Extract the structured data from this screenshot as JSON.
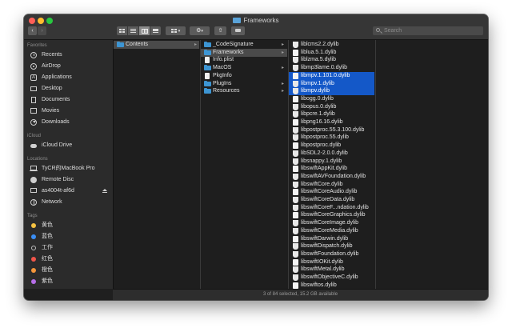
{
  "window": {
    "title": "Frameworks"
  },
  "toolbar": {
    "back_icon": "chevron-left-icon",
    "forward_icon": "chevron-right-icon",
    "view_modes": [
      "icons",
      "list",
      "columns",
      "gallery"
    ],
    "active_view": "columns",
    "search_placeholder": "Search"
  },
  "sidebar": {
    "favorites_header": "Favorites",
    "favorites": [
      {
        "label": "Recents",
        "icon": "recents-icon"
      },
      {
        "label": "AirDrop",
        "icon": "airdrop-icon"
      },
      {
        "label": "Applications",
        "icon": "applications-icon"
      },
      {
        "label": "Desktop",
        "icon": "desktop-icon"
      },
      {
        "label": "Documents",
        "icon": "documents-icon"
      },
      {
        "label": "Movies",
        "icon": "movies-icon"
      },
      {
        "label": "Downloads",
        "icon": "downloads-icon"
      }
    ],
    "icloud_header": "iCloud",
    "icloud": [
      {
        "label": "iCloud Drive",
        "icon": "cloud-icon"
      }
    ],
    "locations_header": "Locations",
    "locations": [
      {
        "label": "TyCR的MacBook Pro",
        "icon": "laptop-icon"
      },
      {
        "label": "Remote Disc",
        "icon": "disc-icon"
      },
      {
        "label": "as4004t-af6d",
        "icon": "display-icon"
      },
      {
        "label": "Network",
        "icon": "network-icon"
      }
    ],
    "tags_header": "Tags",
    "tags": [
      {
        "label": "黄色",
        "color": "#f5c242"
      },
      {
        "label": "蓝色",
        "color": "#3a8ef5"
      },
      {
        "label": "工作",
        "color": "#00000000"
      },
      {
        "label": "红色",
        "color": "#f0554a"
      },
      {
        "label": "橙色",
        "color": "#f5963a"
      },
      {
        "label": "紫色",
        "color": "#b66ee8"
      }
    ]
  },
  "columns": {
    "col1": [
      {
        "label": "Contents",
        "type": "folder",
        "selected": true
      }
    ],
    "col2": [
      {
        "label": "_CodeSignature",
        "type": "folder"
      },
      {
        "label": "Frameworks",
        "type": "folder",
        "selected": true
      },
      {
        "label": "Info.plist",
        "type": "file"
      },
      {
        "label": "MacOS",
        "type": "folder"
      },
      {
        "label": "PkgInfo",
        "type": "file"
      },
      {
        "label": "PlugIns",
        "type": "folder"
      },
      {
        "label": "Resources",
        "type": "folder"
      }
    ],
    "col3": [
      {
        "label": "liblcms2.2.dylib"
      },
      {
        "label": "liblua.5.1.dylib"
      },
      {
        "label": "liblzma.5.dylib"
      },
      {
        "label": "libmp3lame.0.dylib"
      },
      {
        "label": "libmpv.1.101.0.dylib",
        "selected": true
      },
      {
        "label": "libmpv.1.dylib",
        "selected": true
      },
      {
        "label": "libmpv.dylib",
        "selected": true
      },
      {
        "label": "libogg.0.dylib"
      },
      {
        "label": "libopus.0.dylib"
      },
      {
        "label": "libpcre.1.dylib"
      },
      {
        "label": "libpng16.16.dylib"
      },
      {
        "label": "libpostproc.55.3.100.dylib"
      },
      {
        "label": "libpostproc.55.dylib"
      },
      {
        "label": "libpostproc.dylib"
      },
      {
        "label": "libSDL2-2.0.0.dylib"
      },
      {
        "label": "libsnappy.1.dylib"
      },
      {
        "label": "libswiftAppKit.dylib"
      },
      {
        "label": "libswiftAVFoundation.dylib"
      },
      {
        "label": "libswiftCore.dylib"
      },
      {
        "label": "libswiftCoreAudio.dylib"
      },
      {
        "label": "libswiftCoreData.dylib"
      },
      {
        "label": "libswiftCoreF...ndation.dylib"
      },
      {
        "label": "libswiftCoreGraphics.dylib"
      },
      {
        "label": "libswiftCoreImage.dylib"
      },
      {
        "label": "libswiftCoreMedia.dylib"
      },
      {
        "label": "libswiftDarwin.dylib"
      },
      {
        "label": "libswiftDispatch.dylib"
      },
      {
        "label": "libswiftFoundation.dylib"
      },
      {
        "label": "libswiftIOKit.dylib"
      },
      {
        "label": "libswiftMetal.dylib"
      },
      {
        "label": "libswiftObjectiveC.dylib"
      },
      {
        "label": "libswiftos.dylib"
      }
    ]
  },
  "status": {
    "text": "3 of 84 selected, 15.2 GB available"
  }
}
